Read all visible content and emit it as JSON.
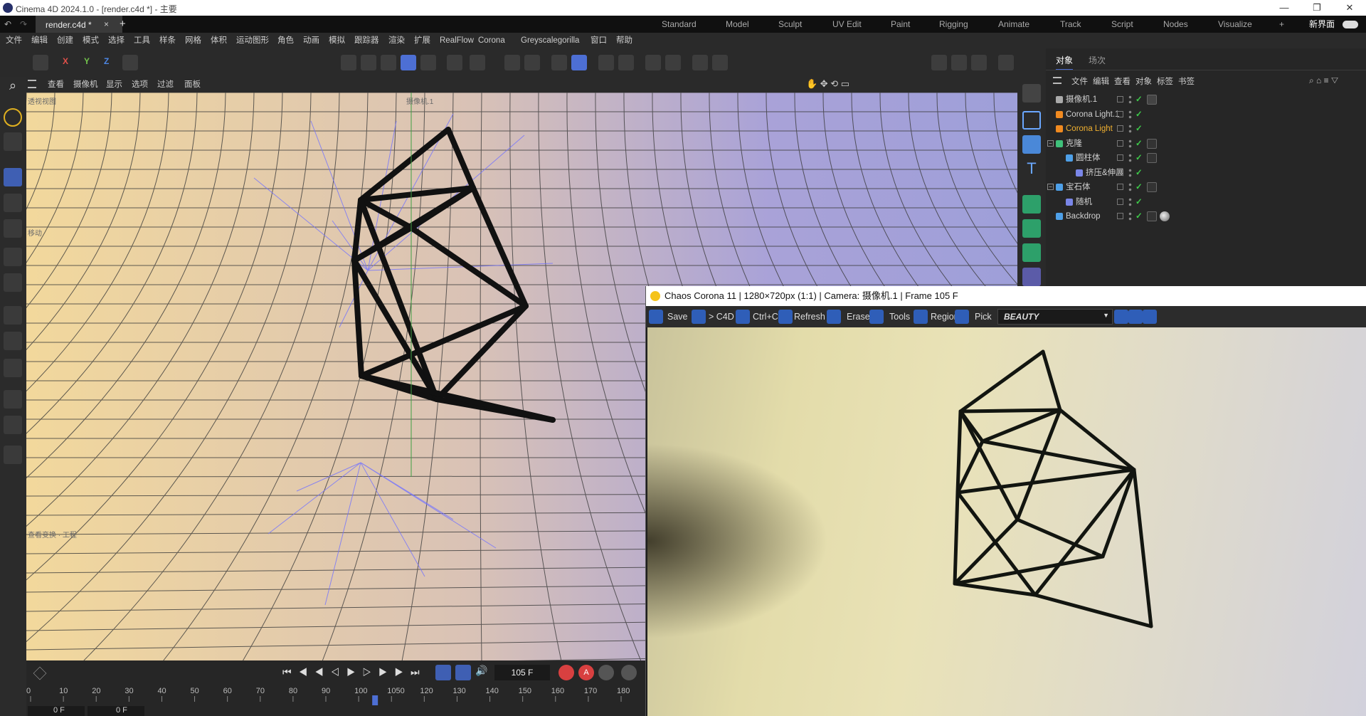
{
  "titlebar": {
    "title": "Cinema 4D 2024.1.0 - [render.c4d *] - 主要",
    "minimize": "—",
    "restore": "❐",
    "close": "✕"
  },
  "tabs": {
    "doc_tab": "render.c4d *",
    "doc_tab_close": "×",
    "new_tab": "+"
  },
  "layouts": [
    "Standard",
    "Model",
    "Sculpt",
    "UV Edit",
    "Paint",
    "Rigging",
    "Animate",
    "Track",
    "Script",
    "Nodes",
    "Visualize",
    "+",
    "新界面"
  ],
  "menu": [
    "文件",
    "编辑",
    "创建",
    "模式",
    "选择",
    "工具",
    "样条",
    "网格",
    "体积",
    "运动图形",
    "角色",
    "动画",
    "模拟",
    "跟踪器",
    "渲染",
    "扩展",
    "RealFlow",
    "Corona",
    "Greyscalegorilla",
    "窗口",
    "帮助"
  ],
  "toolbar": {
    "axis_x": "X",
    "axis_y": "Y",
    "axis_z": "Z"
  },
  "viewport": {
    "menu": [
      "查看",
      "摄像机",
      "显示",
      "选项",
      "过滤",
      "面板"
    ],
    "hud_top_left": "透视视图",
    "hud_camera": "摄像机.1",
    "hud_move": "移动",
    "hud_bottom": "查看变换 · 工程"
  },
  "timeline": {
    "frame_field": "105 F",
    "ruler": [
      "0",
      "10",
      "20",
      "30",
      "40",
      "50",
      "60",
      "70",
      "80",
      "90",
      "100",
      "1050",
      "120",
      "130",
      "140",
      "150",
      "160",
      "170",
      "180"
    ],
    "start_field": "0 F",
    "start_field2": "0 F",
    "current_frame": 105,
    "max_frame": 180
  },
  "object_manager": {
    "tabs": [
      "对象",
      "场次"
    ],
    "menu": [
      "文件",
      "编辑",
      "查看",
      "对象",
      "标签",
      "书签"
    ],
    "rows": [
      {
        "name": "摄像机.1",
        "indent": 0,
        "color": "#cfcfcf",
        "icon": "camera-icon"
      },
      {
        "name": "Corona Light.1",
        "indent": 0,
        "color": "#cfcfcf",
        "icon": "light-bulb-icon"
      },
      {
        "name": "Corona Light",
        "indent": 0,
        "color": "#f0b030",
        "icon": "light-bulb-icon"
      },
      {
        "name": "克隆",
        "indent": 0,
        "color": "#cfcfcf",
        "icon": "cloner-icon"
      },
      {
        "name": "圆柱体",
        "indent": 1,
        "color": "#cfcfcf",
        "icon": "cylinder-icon"
      },
      {
        "name": "挤压&伸展",
        "indent": 2,
        "color": "#cfcfcf",
        "icon": "deformer-icon"
      },
      {
        "name": "宝石体",
        "indent": 0,
        "color": "#cfcfcf",
        "icon": "gem-icon"
      },
      {
        "name": "随机",
        "indent": 1,
        "color": "#cfcfcf",
        "icon": "random-effector-icon"
      },
      {
        "name": "Backdrop",
        "indent": 0,
        "color": "#cfcfcf",
        "icon": "backdrop-icon"
      }
    ]
  },
  "corona": {
    "title": "Chaos Corona 11 | 1280×720px (1:1) | Camera: 摄像机.1 | Frame 105 F",
    "buttons": {
      "save": "Save",
      "to_c4d": "> C4D",
      "copy": "Ctrl+C",
      "refresh": "Refresh",
      "erase": "Erase",
      "tools": "Tools",
      "region": "Region",
      "pick": "Pick"
    },
    "channel": "BEAUTY"
  },
  "colors": {
    "accent": "#4d6fd4",
    "corona_light": "#f0b030",
    "check": "#3ec94a"
  }
}
